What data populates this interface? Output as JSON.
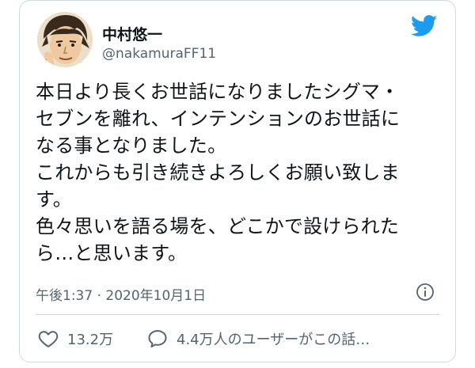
{
  "author": {
    "display_name": "中村悠一",
    "handle": "@nakamuraFF11"
  },
  "tweet": {
    "lines": [
      "本日より長くお世話になりましたシグマ・",
      "セブンを離れ、インテンションのお世話に",
      "なる事となりました。",
      "これからも引き続きよろしくお願い致しま",
      "す。",
      "色々思いを語る場を、どこかで設けられた",
      "ら…と思います。"
    ],
    "timestamp": "午後1:37 · 2020年10月1日"
  },
  "actions": {
    "like_count": "13.2万",
    "reply_summary": "4.4万人のユーザーがこの話…"
  },
  "icons": {
    "brand": "twitter-bird-icon",
    "info": "info-icon",
    "like": "heart-icon",
    "reply": "speech-bubble-icon"
  },
  "colors": {
    "brand": "#1d9bf0",
    "text": "#0f1419",
    "secondary_text": "#536471",
    "border": "#cfd9de"
  }
}
